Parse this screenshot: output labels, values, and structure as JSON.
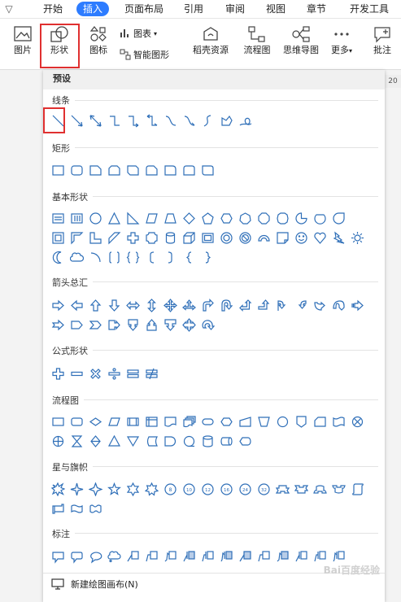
{
  "menubar": {
    "tabs": [
      "开始",
      "插入",
      "页面布局",
      "引用",
      "审阅",
      "视图",
      "章节",
      "开发工具"
    ],
    "active": "插入"
  },
  "ribbon": {
    "picture": "图片",
    "shape": "形状",
    "icon": "图标",
    "chart": "图表",
    "smart_graphic": "智能图形",
    "docer_resources": "稻壳资源",
    "flowchart": "流程图",
    "mindmap": "思维导图",
    "more": "更多",
    "comment": "批注"
  },
  "panel": {
    "header": "预设",
    "ruler_number": "20",
    "sections": {
      "lines": "线条",
      "rect": "矩形",
      "basic": "基本形状",
      "arrows": "箭头总汇",
      "equation": "公式形状",
      "flowchart": "流程图",
      "stars": "星与旗帜",
      "callouts": "标注"
    },
    "footer": "新建绘图画布(N)"
  },
  "colors": {
    "accent": "#2d7cff",
    "highlight": "#e03030",
    "shape_stroke": "#2f6fb8"
  },
  "watermark": "Bai百度经验"
}
